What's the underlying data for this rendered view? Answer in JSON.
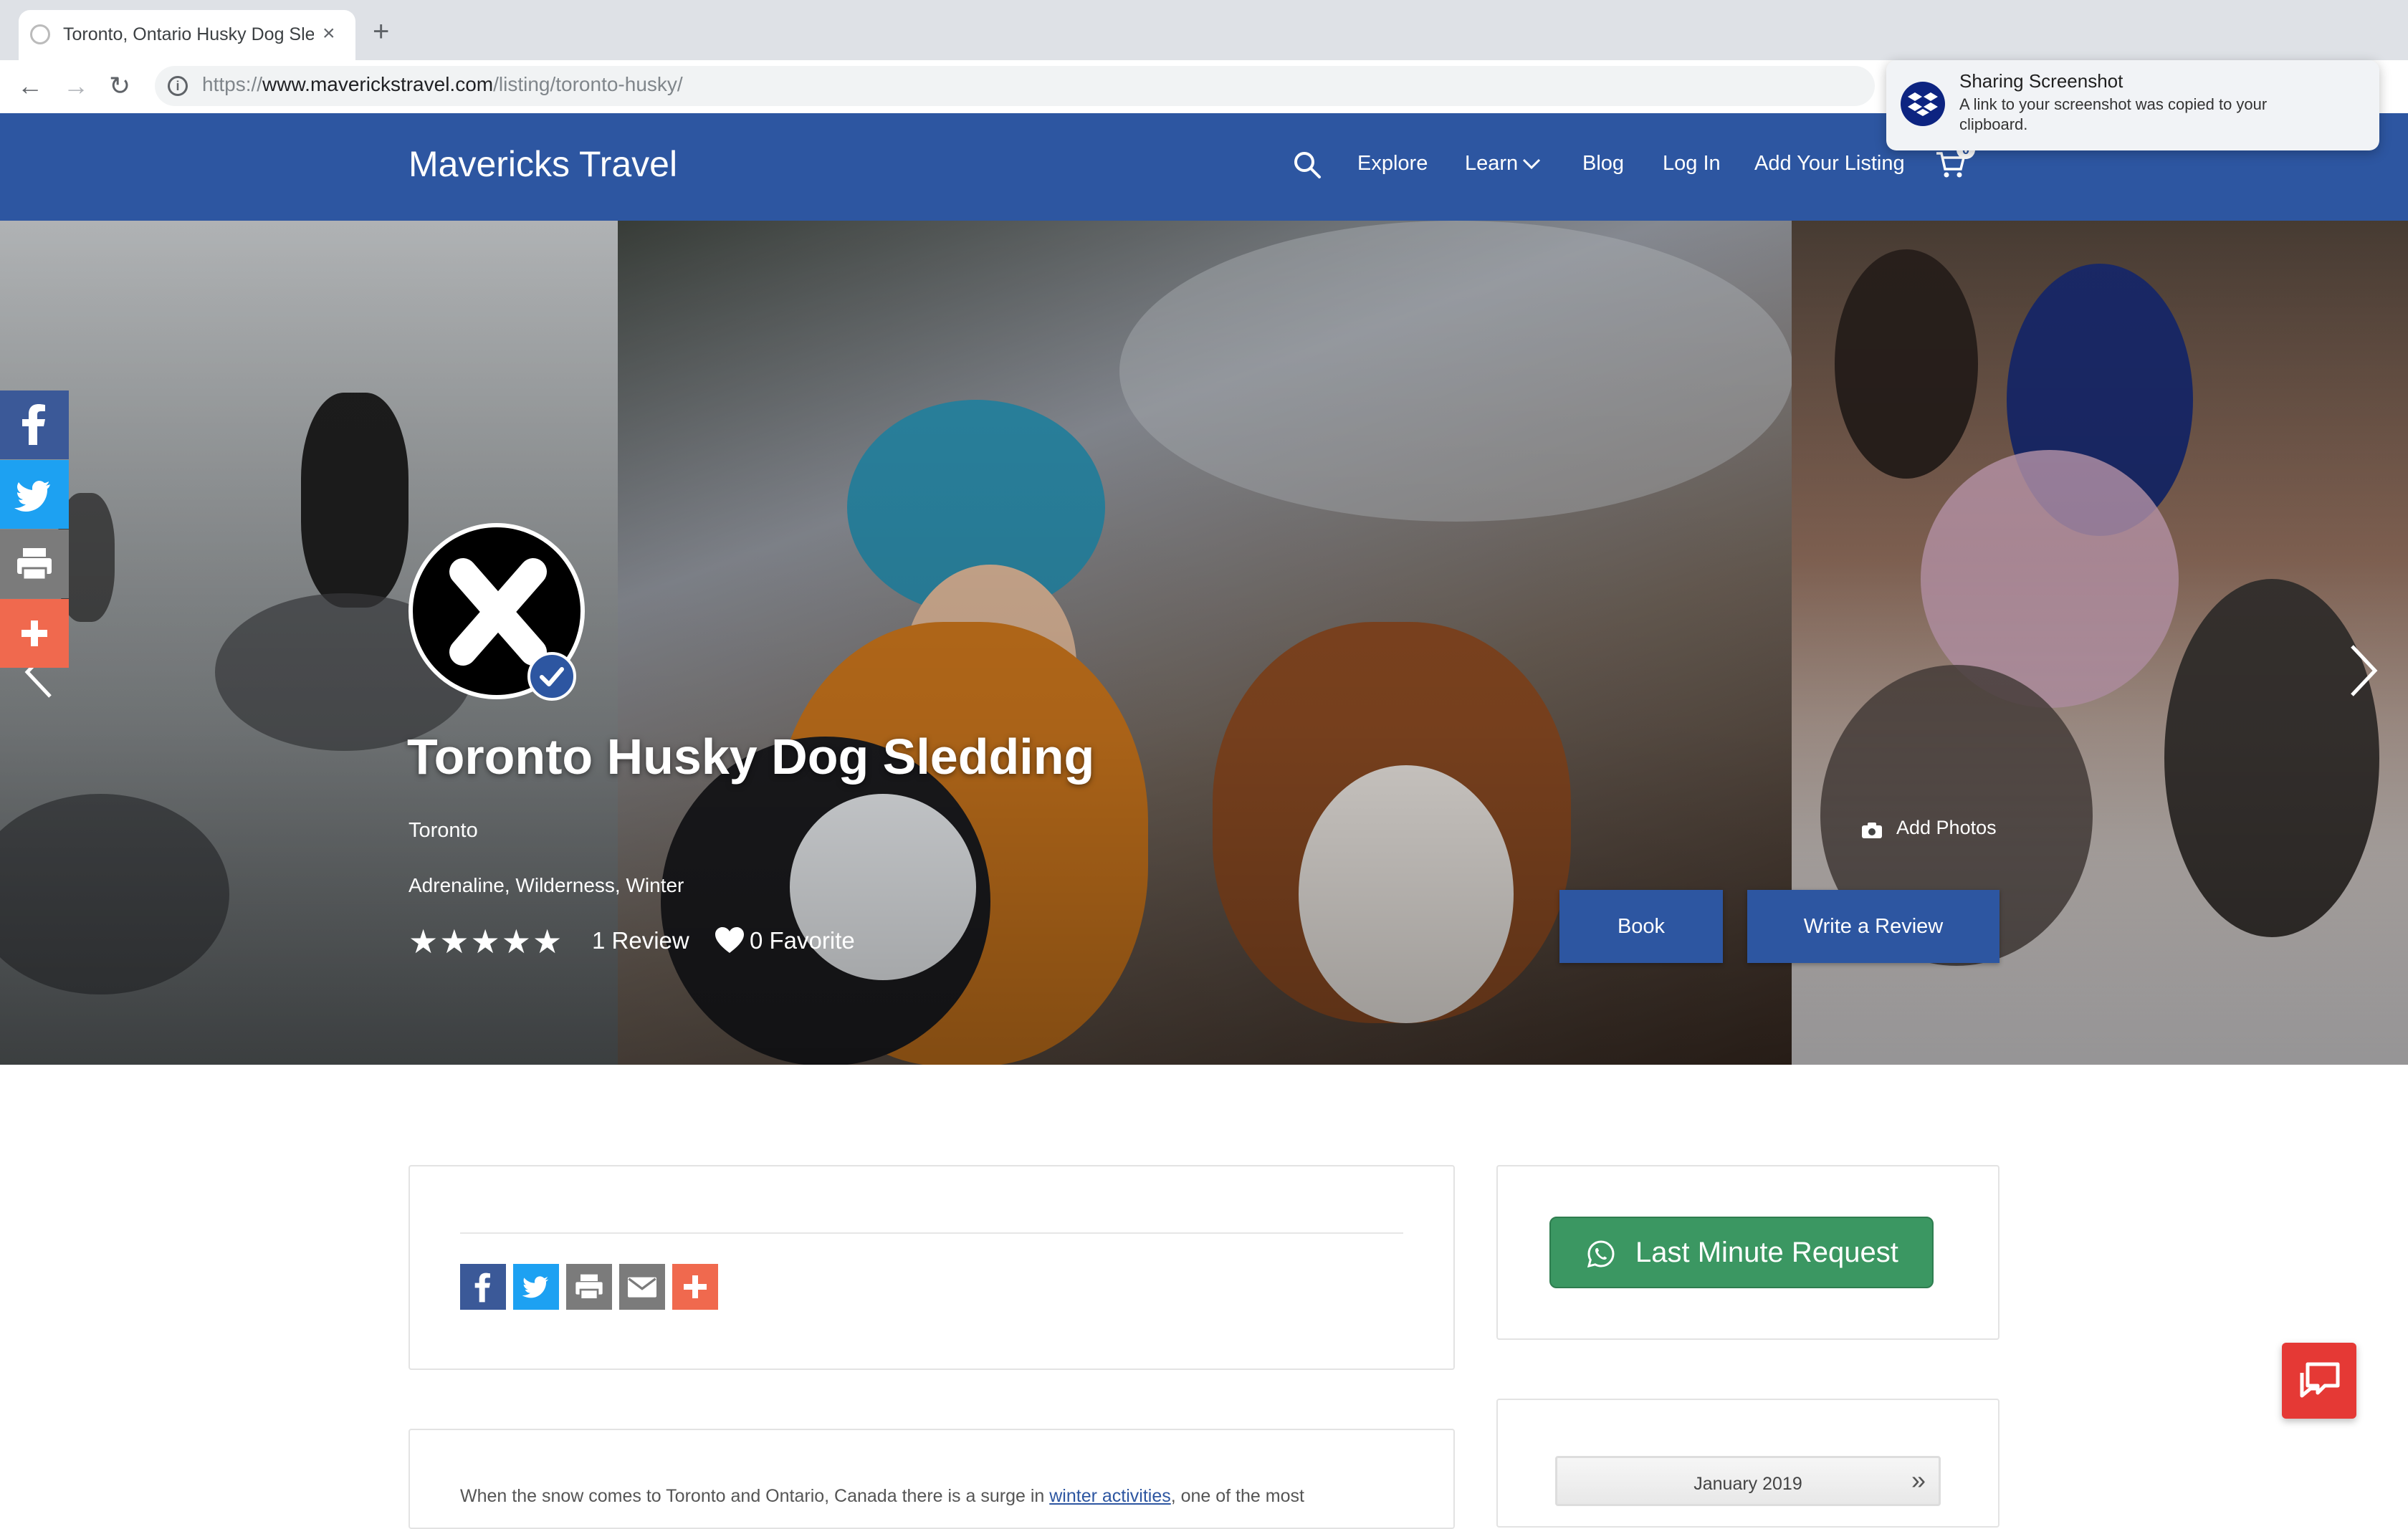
{
  "browser": {
    "tab_title": "Toronto, Ontario Husky Dog Sledding | Mavericks Travel",
    "tab_close": "×",
    "new_tab": "+",
    "url_prefix": "https://",
    "url_host": "www.maverickstravel.com",
    "url_path": "/listing/toronto-husky/"
  },
  "notification": {
    "title": "Sharing Screenshot",
    "message": "A link to your screenshot was copied to your clipboard."
  },
  "header": {
    "logo": "Mavericks Travel",
    "nav": [
      "Explore",
      "Learn",
      "Blog",
      "Log In",
      "Add Your Listing"
    ],
    "cart_count": "0"
  },
  "listing": {
    "title": "Toronto Husky Dog Sledding",
    "location": "Toronto",
    "tags": "Adrenaline, Wilderness, Winter",
    "rating": 5,
    "review_count": "1 Review",
    "favorite_count": "0 Favorite",
    "add_photos": "Add Photos",
    "book_label": "Book",
    "review_label": "Write a Review"
  },
  "sidebar": {
    "last_minute_label": "Last Minute Request",
    "calendar_month": "January 2019",
    "calendar_next": "»"
  },
  "description": {
    "before_link": "When the snow comes to Toronto and Ontario, Canada there is a surge in ",
    "link": "winter activities",
    "after_link": ", one of the most"
  },
  "colors": {
    "brand": "#2d56a1",
    "facebook": "#3b5998",
    "twitter": "#1da1f2",
    "print": "#7b7b7b",
    "share_more": "#f0694e",
    "whatsapp_green": "#3b9762",
    "chat_red": "#e53935"
  }
}
